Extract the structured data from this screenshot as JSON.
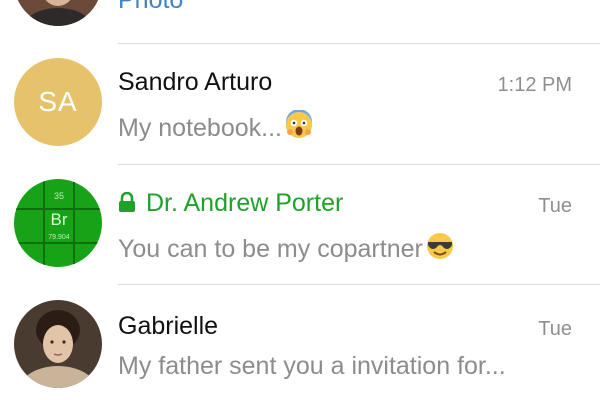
{
  "chats": [
    {
      "preview": "Photo"
    },
    {
      "avatar_initials": "SA",
      "name": "Sandro Arturo",
      "time": "1:12 PM",
      "preview": "My notebook...",
      "emoji_icon": "face-screaming-in-fear-icon",
      "avatar_color": "#e6c36a"
    },
    {
      "name": "Dr. Andrew Porter",
      "time": "Tue",
      "preview": "You can to be my copartner",
      "emoji_icon": "smiling-face-with-sunglasses-icon",
      "secret_chat": true,
      "avatar_image_text": [
        "35",
        "Br",
        "79.904"
      ]
    },
    {
      "name": "Gabrielle",
      "time": "Tue",
      "preview": "My father sent you a invitation for..."
    }
  ],
  "colors": {
    "secret_name": "#1fa12a",
    "media_preview": "#3d83c9",
    "name": "#111111",
    "preview": "#8c8c8c",
    "time": "#8f8f8f",
    "divider": "#dcdcdc"
  }
}
